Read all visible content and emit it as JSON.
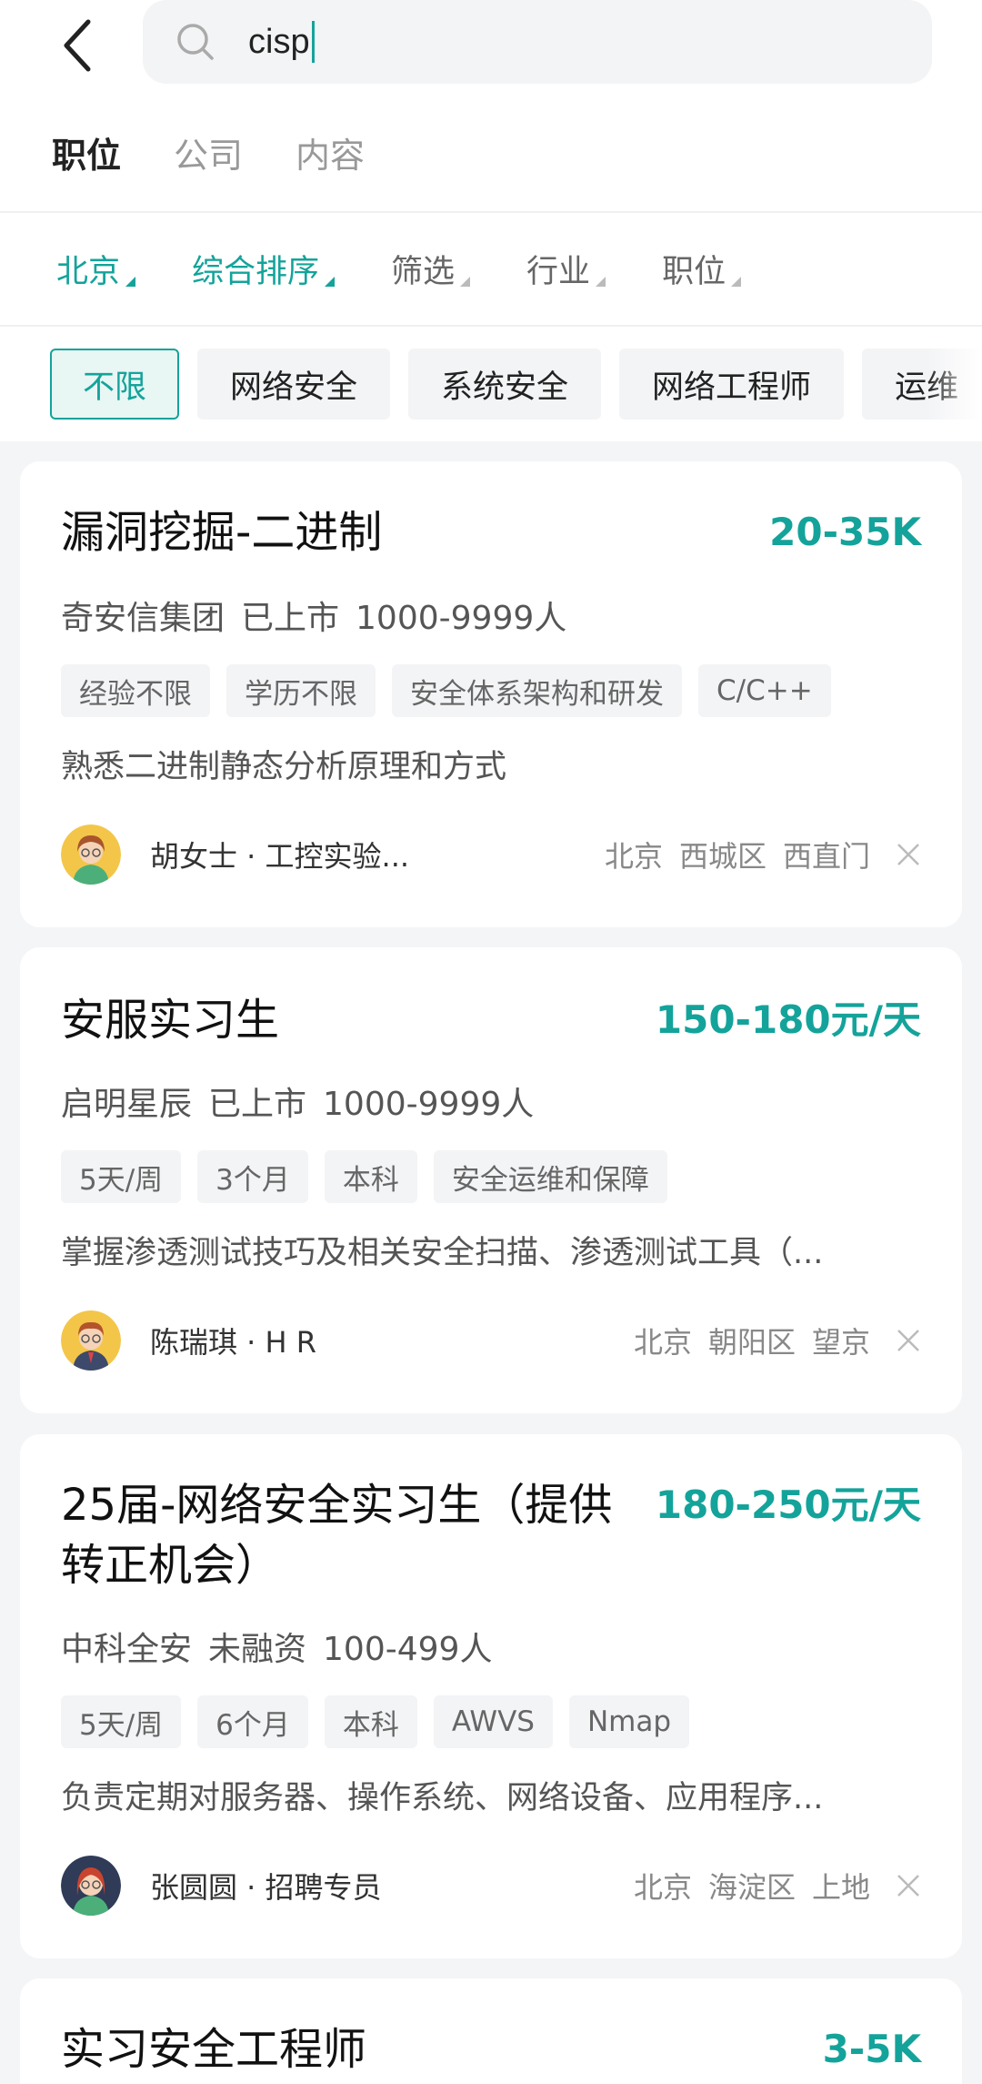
{
  "search": {
    "query": "cisp"
  },
  "tabs": [
    {
      "label": "职位"
    },
    {
      "label": "公司"
    },
    {
      "label": "内容"
    }
  ],
  "filters": [
    {
      "label": "北京"
    },
    {
      "label": "综合排序"
    },
    {
      "label": "筛选"
    },
    {
      "label": "行业"
    },
    {
      "label": "职位"
    }
  ],
  "chips": [
    {
      "label": "不限"
    },
    {
      "label": "网络安全"
    },
    {
      "label": "系统安全"
    },
    {
      "label": "网络工程师"
    },
    {
      "label": "运维"
    }
  ],
  "jobs": [
    {
      "title": "漏洞挖掘-二进制",
      "salary": "20-35K",
      "company": "奇安信集团",
      "stage": "已上市",
      "size": "1000-9999人",
      "tags": [
        "经验不限",
        "学历不限",
        "安全体系架构和研发",
        "C/C++"
      ],
      "desc": "熟悉二进制静态分析原理和方式",
      "recruiter": "胡女士 · 工控实验...",
      "loc": [
        "北京",
        "西城区",
        "西直门"
      ]
    },
    {
      "title": "安服实习生",
      "salary": "150-180元/天",
      "company": "启明星辰",
      "stage": "已上市",
      "size": "1000-9999人",
      "tags": [
        "5天/周",
        "3个月",
        "本科",
        "安全运维和保障"
      ],
      "desc": "掌握渗透测试技巧及相关安全扫描、渗透测试工具（...",
      "recruiter": "陈瑞琪 · H R",
      "loc": [
        "北京",
        "朝阳区",
        "望京"
      ]
    },
    {
      "title": "25届-网络安全实习生（提供转正机会）",
      "salary": "180-250元/天",
      "company": "中科全安",
      "stage": "未融资",
      "size": "100-499人",
      "tags": [
        "5天/周",
        "6个月",
        "本科",
        "AWVS",
        "Nmap"
      ],
      "desc": "负责定期对服务器、操作系统、网络设备、应用程序...",
      "recruiter": "张圆圆 · 招聘专员",
      "loc": [
        "北京",
        "海淀区",
        "上地"
      ]
    },
    {
      "title": "实习安全工程师",
      "salary": "3-5K"
    }
  ],
  "colors": {
    "accent": "#14a39a",
    "background": "#f4f5f7"
  }
}
